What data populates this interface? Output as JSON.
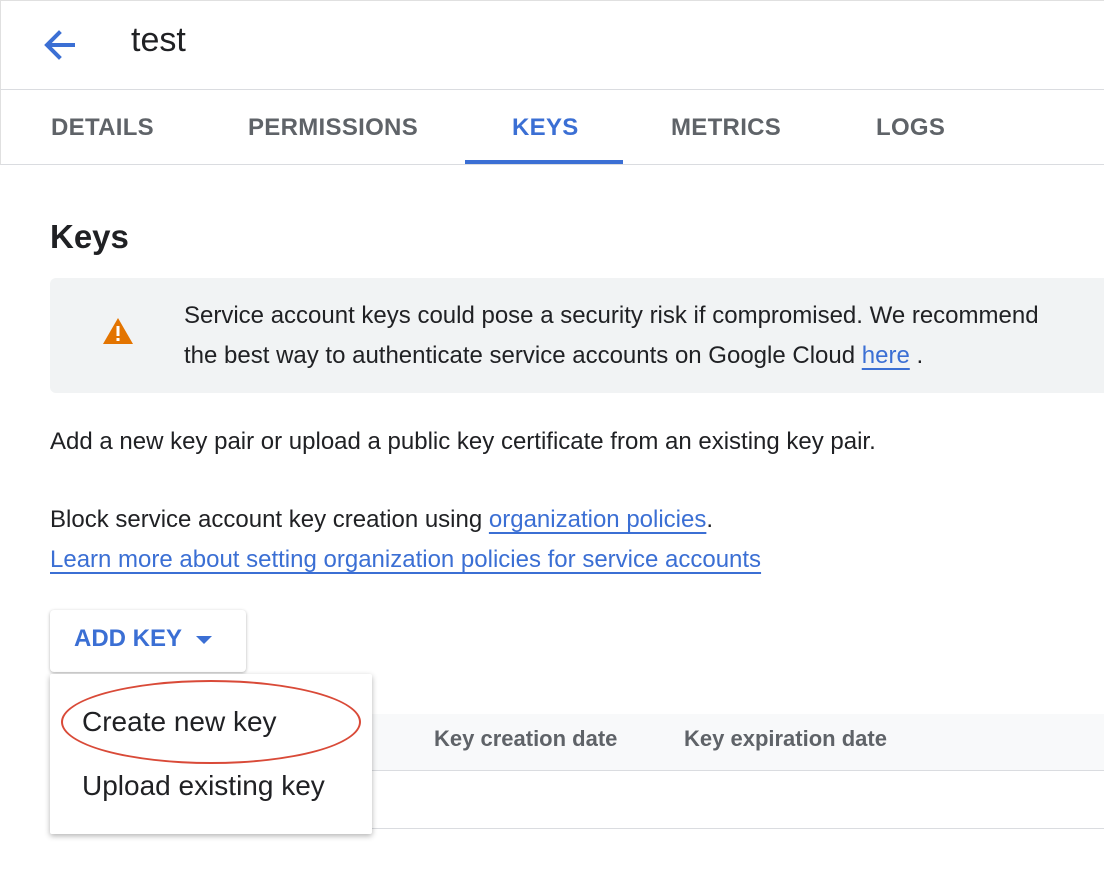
{
  "header": {
    "title": "test",
    "back_icon": "arrow-back-icon"
  },
  "tabs": [
    {
      "label": "DETAILS",
      "active": false
    },
    {
      "label": "PERMISSIONS",
      "active": false
    },
    {
      "label": "KEYS",
      "active": true
    },
    {
      "label": "METRICS",
      "active": false
    },
    {
      "label": "LOGS",
      "active": false
    }
  ],
  "section": {
    "title": "Keys",
    "notice": {
      "icon": "warning-icon",
      "line1": "Service account keys could pose a security risk if compromised. We recommend",
      "line2": "the best way to authenticate service accounts on Google Cloud ",
      "link": "here",
      "suffix": " ."
    },
    "intro": "Add a new key pair or upload a public key certificate from an existing key pair.",
    "block_text": "Block service account key creation using ",
    "block_link": "organization policies",
    "block_suffix": ".",
    "learn_more": "Learn more about setting organization policies for service accounts"
  },
  "add_key": {
    "label": "ADD KEY",
    "menu": [
      "Create new key",
      "Upload existing key"
    ]
  },
  "table": {
    "columns": [
      "Key creation date",
      "Key expiration date"
    ]
  },
  "colors": {
    "accent": "#3b6fd4",
    "warning": "#e37400",
    "highlight": "#d94a38"
  }
}
